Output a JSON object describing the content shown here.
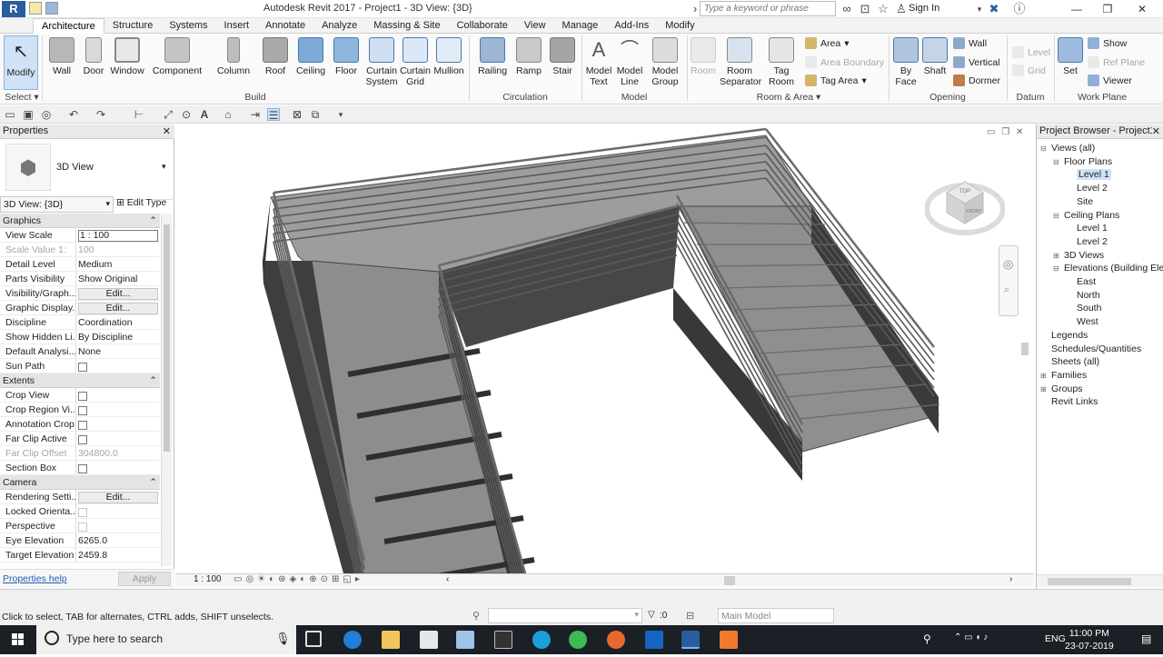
{
  "title_bar": {
    "app_letter": "R",
    "title": "Autodesk Revit 2017 -     Project1 - 3D View: {3D}",
    "search_placeholder": "Type a keyword or phrase",
    "sign_in": "Sign In"
  },
  "tabs": [
    "Architecture",
    "Structure",
    "Systems",
    "Insert",
    "Annotate",
    "Analyze",
    "Massing & Site",
    "Collaborate",
    "View",
    "Manage",
    "Add-Ins",
    "Modify"
  ],
  "ribbon": {
    "modify": "Modify",
    "select": "Select",
    "build": {
      "label": "Build",
      "buttons": [
        "Wall",
        "Door",
        "Window",
        "Component",
        "Column",
        "Roof",
        "Ceiling",
        "Floor",
        "Curtain System",
        "Curtain Grid",
        "Mullion"
      ]
    },
    "circulation": {
      "label": "Circulation",
      "buttons": [
        "Railing",
        "Ramp",
        "Stair"
      ]
    },
    "model": {
      "label": "Model",
      "buttons": [
        "Model Text",
        "Model Line",
        "Model Group"
      ]
    },
    "room_area": {
      "label": "Room & Area",
      "buttons": [
        "Room",
        "Room Separator",
        "Tag Room"
      ],
      "small": [
        "Area",
        "Area  Boundary",
        "Tag  Area"
      ]
    },
    "opening": {
      "label": "Opening",
      "buttons": [
        "By Face",
        "Shaft"
      ],
      "small": [
        "Wall",
        "Vertical",
        "Dormer"
      ]
    },
    "datum": {
      "label": "Datum",
      "small": [
        "Level",
        "Grid"
      ]
    },
    "work_plane": {
      "label": "Work Plane",
      "set": "Set",
      "small": [
        "Show",
        "Ref  Plane",
        "Viewer"
      ]
    }
  },
  "properties": {
    "title": "Properties",
    "type_name": "3D View",
    "view_selector": "3D View: {3D}",
    "edit_type": "Edit Type",
    "groups": [
      {
        "name": "Graphics",
        "rows": [
          {
            "k": "View Scale",
            "v": "1 : 100",
            "kind": "input"
          },
          {
            "k": "Scale Value    1:",
            "v": "100",
            "kind": "dis"
          },
          {
            "k": "Detail Level",
            "v": "Medium"
          },
          {
            "k": "Parts Visibility",
            "v": "Show Original"
          },
          {
            "k": "Visibility/Graph...",
            "v": "Edit...",
            "kind": "btn"
          },
          {
            "k": "Graphic Display...",
            "v": "Edit...",
            "kind": "btn"
          },
          {
            "k": "Discipline",
            "v": "Coordination"
          },
          {
            "k": "Show Hidden Li...",
            "v": "By Discipline"
          },
          {
            "k": "Default Analysi...",
            "v": "None"
          },
          {
            "k": "Sun Path",
            "v": "",
            "kind": "cb"
          }
        ]
      },
      {
        "name": "Extents",
        "rows": [
          {
            "k": "Crop View",
            "v": "",
            "kind": "cb"
          },
          {
            "k": "Crop Region Vi...",
            "v": "",
            "kind": "cb"
          },
          {
            "k": "Annotation Crop",
            "v": "",
            "kind": "cb"
          },
          {
            "k": "Far Clip Active",
            "v": "",
            "kind": "cb"
          },
          {
            "k": "Far Clip Offset",
            "v": "304800.0",
            "kind": "dis"
          },
          {
            "k": "Section Box",
            "v": "",
            "kind": "cb"
          }
        ]
      },
      {
        "name": "Camera",
        "rows": [
          {
            "k": "Rendering Setti...",
            "v": "Edit...",
            "kind": "btn"
          },
          {
            "k": "Locked Orienta...",
            "v": "",
            "kind": "cbdis"
          },
          {
            "k": "Perspective",
            "v": "",
            "kind": "cbdis"
          },
          {
            "k": "Eye Elevation",
            "v": "6265.0"
          },
          {
            "k": "Target Elevation",
            "v": "2459.8"
          }
        ]
      }
    ],
    "help": "Properties help",
    "apply": "Apply"
  },
  "view": {
    "scale": "1 : 100"
  },
  "viewcube": {
    "top": "TOP",
    "front": "FRONT"
  },
  "browser": {
    "title": "Project Browser - Project1",
    "nodes": [
      {
        "label": "Views (all)",
        "lvl": 0,
        "tog": "−"
      },
      {
        "label": "Floor Plans",
        "lvl": 1,
        "tog": "−"
      },
      {
        "label": "Level 1",
        "lvl": 2,
        "sel": true
      },
      {
        "label": "Level 2",
        "lvl": 2
      },
      {
        "label": "Site",
        "lvl": 2
      },
      {
        "label": "Ceiling Plans",
        "lvl": 1,
        "tog": "−"
      },
      {
        "label": "Level 1",
        "lvl": 2
      },
      {
        "label": "Level 2",
        "lvl": 2
      },
      {
        "label": "3D Views",
        "lvl": 1,
        "tog": "+"
      },
      {
        "label": "Elevations (Building Elevation)",
        "lvl": 1,
        "tog": "−"
      },
      {
        "label": "East",
        "lvl": 2
      },
      {
        "label": "North",
        "lvl": 2
      },
      {
        "label": "South",
        "lvl": 2
      },
      {
        "label": "West",
        "lvl": 2
      },
      {
        "label": "Legends",
        "lvl": 0
      },
      {
        "label": "Schedules/Quantities",
        "lvl": 0
      },
      {
        "label": "Sheets (all)",
        "lvl": 0
      },
      {
        "label": "Families",
        "lvl": 0,
        "tog": "+"
      },
      {
        "label": "Groups",
        "lvl": 0,
        "tog": "+"
      },
      {
        "label": "Revit Links",
        "lvl": 0
      }
    ]
  },
  "status": {
    "text": "Click to select, TAB for alternates, CTRL adds, SHIFT unselects.",
    "count": ":0",
    "main_model": "Main Model"
  },
  "taskbar": {
    "search": "Type here to search",
    "lang": "ENG",
    "time": "11:00 PM",
    "date": "23-07-2019"
  },
  "colors": {
    "floor": "#9c9c9c",
    "side": "#3f3f3f",
    "rail": "#555555",
    "accent": "#2a5d9e"
  }
}
